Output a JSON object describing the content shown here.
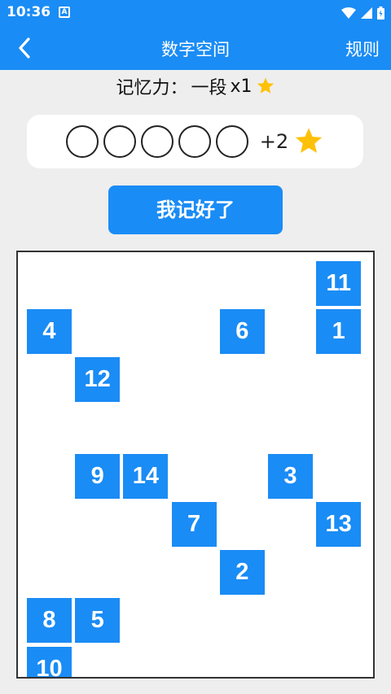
{
  "status": {
    "time": "10:36",
    "badge": "A"
  },
  "app_bar": {
    "title": "数字空间",
    "rules_label": "规则"
  },
  "memory": {
    "label": "记忆力：",
    "level": "一段",
    "multiplier": "x1"
  },
  "answer": {
    "slot_count": 5,
    "reward": "+2"
  },
  "action": {
    "remember_label": "我记好了"
  },
  "colors": {
    "primary": "#1a8cf5",
    "star": "#ffc107",
    "background": "#eeeeee"
  },
  "board": {
    "tiles": [
      {
        "value": "11",
        "col": 6,
        "row": 0
      },
      {
        "value": "4",
        "col": 0,
        "row": 1
      },
      {
        "value": "6",
        "col": 4,
        "row": 1
      },
      {
        "value": "1",
        "col": 6,
        "row": 1
      },
      {
        "value": "12",
        "col": 1,
        "row": 2
      },
      {
        "value": "9",
        "col": 1,
        "row": 4
      },
      {
        "value": "14",
        "col": 2,
        "row": 4
      },
      {
        "value": "3",
        "col": 5,
        "row": 4
      },
      {
        "value": "7",
        "col": 3,
        "row": 5
      },
      {
        "value": "13",
        "col": 6,
        "row": 5
      },
      {
        "value": "2",
        "col": 4,
        "row": 6
      },
      {
        "value": "8",
        "col": 0,
        "row": 7
      },
      {
        "value": "5",
        "col": 1,
        "row": 7
      },
      {
        "value": "10",
        "col": 0,
        "row": 8
      }
    ]
  }
}
